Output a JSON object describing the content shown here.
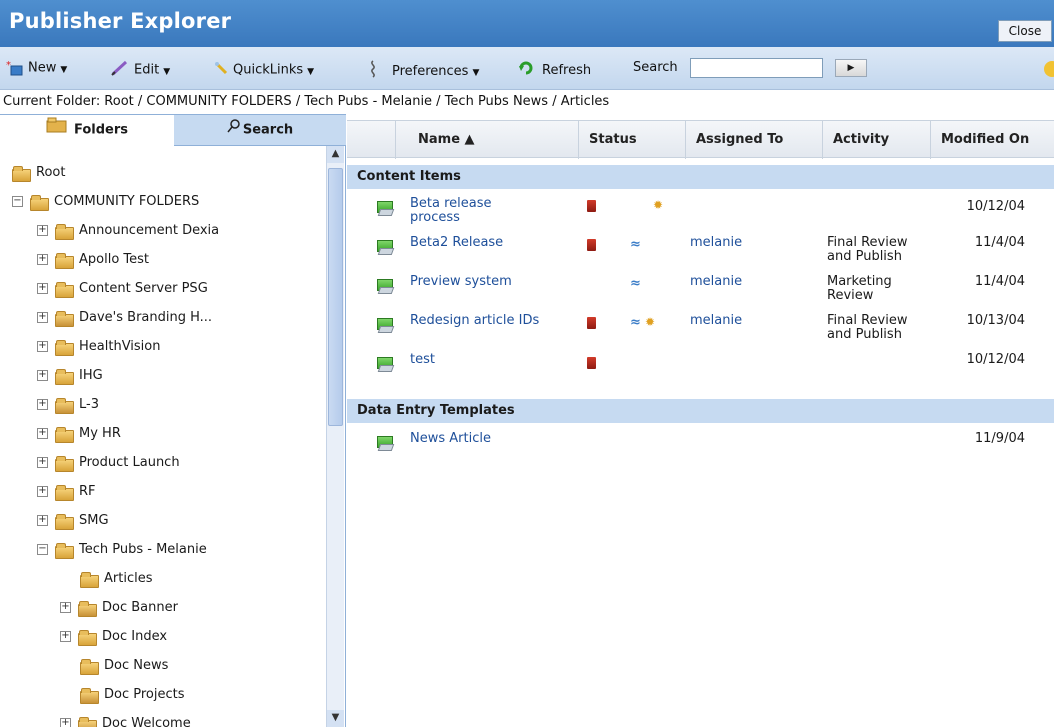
{
  "window": {
    "title": "Publisher Explorer",
    "close_label": "Close"
  },
  "toolbar": {
    "new_label": "New",
    "edit_label": "Edit",
    "quicklinks_label": "QuickLinks",
    "preferences_label": "Preferences",
    "refresh_label": "Refresh",
    "search_label": "Search",
    "search_value": ""
  },
  "breadcrumb": {
    "prefix": "Current Folder:",
    "path": "Root / COMMUNITY FOLDERS / Tech Pubs - Melanie / Tech Pubs News / Articles"
  },
  "left_tabs": {
    "folders": "Folders",
    "search": "Search"
  },
  "tree": [
    {
      "label": "Root",
      "expander": "",
      "icon": "folder-icon"
    },
    {
      "label": "COMMUNITY FOLDERS",
      "expander": "−",
      "icon": "folder-icon"
    },
    {
      "label": "Announcement Dexia",
      "expander": "+",
      "icon": "folder-icon"
    },
    {
      "label": "Apollo Test",
      "expander": "+",
      "icon": "folder-icon"
    },
    {
      "label": "Content Server PSG",
      "expander": "+",
      "icon": "folder-icon"
    },
    {
      "label": "Dave's Branding H...",
      "expander": "+",
      "icon": "gear-folder-icon"
    },
    {
      "label": "HealthVision",
      "expander": "+",
      "icon": "folder-icon"
    },
    {
      "label": "IHG",
      "expander": "+",
      "icon": "folder-icon"
    },
    {
      "label": "L-3",
      "expander": "+",
      "icon": "gear-folder-icon"
    },
    {
      "label": "My HR",
      "expander": "+",
      "icon": "folder-icon"
    },
    {
      "label": "Product Launch",
      "expander": "+",
      "icon": "folder-icon"
    },
    {
      "label": "RF",
      "expander": "+",
      "icon": "folder-icon"
    },
    {
      "label": "SMG",
      "expander": "+",
      "icon": "folder-icon"
    },
    {
      "label": "Tech Pubs - Melanie",
      "expander": "−",
      "icon": "folder-icon"
    },
    {
      "label": "Articles",
      "expander": "",
      "icon": "folder-icon"
    },
    {
      "label": "Doc Banner",
      "expander": "+",
      "icon": "gear-folder-icon"
    },
    {
      "label": "Doc Index",
      "expander": "+",
      "icon": "folder-icon"
    },
    {
      "label": "Doc News",
      "expander": "",
      "icon": "folder-icon"
    },
    {
      "label": "Doc Projects",
      "expander": "",
      "icon": "gear-folder-icon"
    },
    {
      "label": "Doc Welcome",
      "expander": "+",
      "icon": "gear-folder-icon"
    }
  ],
  "table": {
    "columns": [
      "Name ▲",
      "Status",
      "Assigned To",
      "Activity",
      "Modified On"
    ],
    "sections": [
      {
        "title": "Content Items",
        "rows": [
          {
            "name_line1": "Beta release",
            "name_line2": "process",
            "assigned": "",
            "activity_line1": "",
            "activity_line2": "",
            "modified": "10/12/04",
            "status": [
              "doc",
              "",
              "gear"
            ]
          },
          {
            "name_line1": "Beta2 Release",
            "name_line2": "",
            "assigned": "melanie",
            "activity_line1": "Final Review",
            "activity_line2": "and Publish",
            "modified": "11/4/04",
            "status": [
              "doc",
              "workflow",
              ""
            ]
          },
          {
            "name_line1": "Preview system",
            "name_line2": "",
            "assigned": "melanie",
            "activity_line1": "Marketing",
            "activity_line2": "Review",
            "modified": "11/4/04",
            "status": [
              "",
              "workflow",
              ""
            ]
          },
          {
            "name_line1": "Redesign article IDs",
            "name_line2": "",
            "assigned": "melanie",
            "activity_line1": "Final Review",
            "activity_line2": "and Publish",
            "modified": "10/13/04",
            "status": [
              "doc",
              "workflow",
              "gear"
            ]
          },
          {
            "name_line1": "test",
            "name_line2": "",
            "assigned": "",
            "activity_line1": "",
            "activity_line2": "",
            "modified": "10/12/04",
            "status": [
              "doc",
              "",
              ""
            ]
          }
        ]
      },
      {
        "title": "Data Entry Templates",
        "rows": [
          {
            "name_line1": "News Article",
            "name_line2": "",
            "assigned": "",
            "activity_line1": "",
            "activity_line2": "",
            "modified": "11/9/04",
            "status": [
              "",
              "",
              ""
            ]
          }
        ]
      }
    ]
  }
}
